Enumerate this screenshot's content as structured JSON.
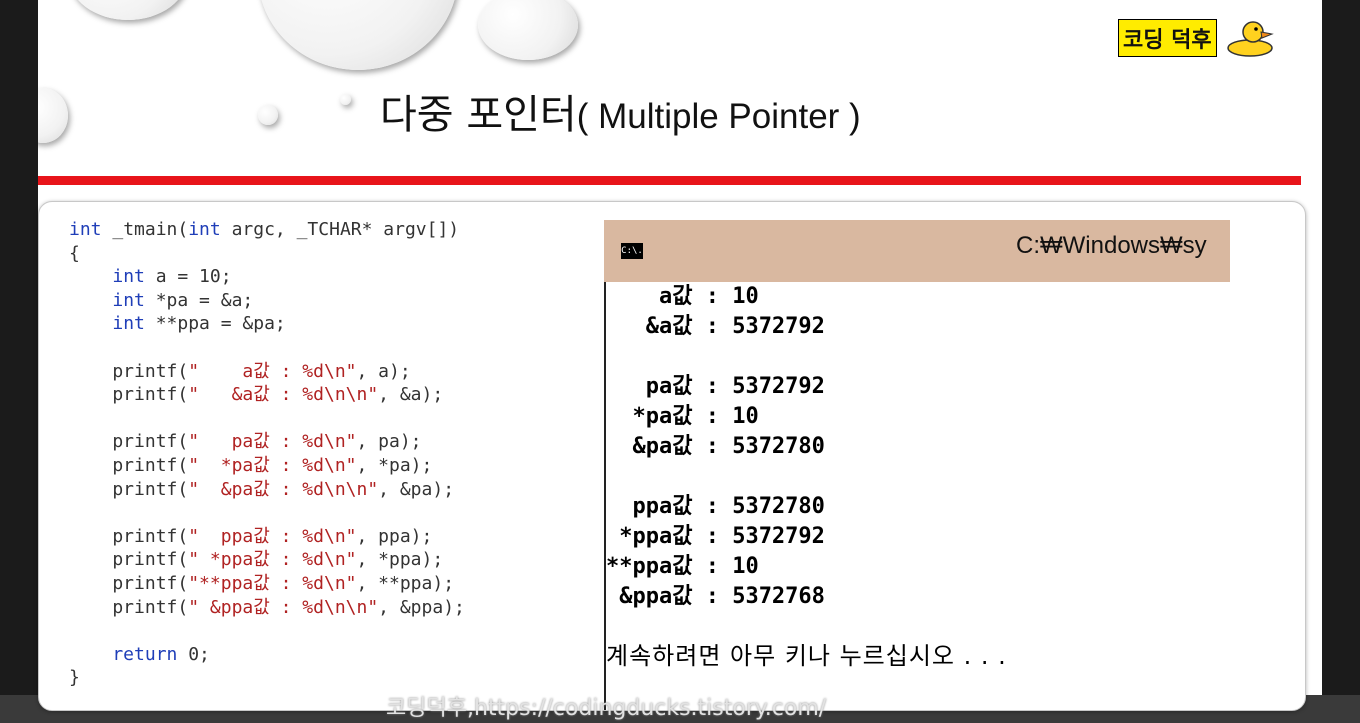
{
  "slide": {
    "title_korean": "다중 포인터",
    "title_english": "( Multiple Pointer )",
    "brand": "코딩 덕후",
    "watermark": "코딩덕후,https://codingducks.tistory.com/"
  },
  "code_lines": [
    [
      {
        "t": "int",
        "c": "kw"
      },
      {
        "t": " _tmain("
      },
      {
        "t": "int",
        "c": "kw"
      },
      {
        "t": " argc, _TCHAR* argv[])"
      }
    ],
    [
      {
        "t": "{"
      }
    ],
    [
      {
        "t": "    "
      },
      {
        "t": "int",
        "c": "kw"
      },
      {
        "t": " a = 10;"
      }
    ],
    [
      {
        "t": "    "
      },
      {
        "t": "int",
        "c": "kw"
      },
      {
        "t": " *pa = &a;"
      }
    ],
    [
      {
        "t": "    "
      },
      {
        "t": "int",
        "c": "kw"
      },
      {
        "t": " **ppa = &pa;"
      }
    ],
    [],
    [
      {
        "t": "    printf("
      },
      {
        "t": "\"    a값 : %d\\n\"",
        "c": "str"
      },
      {
        "t": ", a);"
      }
    ],
    [
      {
        "t": "    printf("
      },
      {
        "t": "\"   &a값 : %d\\n\\n\"",
        "c": "str"
      },
      {
        "t": ", &a);"
      }
    ],
    [],
    [
      {
        "t": "    printf("
      },
      {
        "t": "\"   pa값 : %d\\n\"",
        "c": "str"
      },
      {
        "t": ", pa);"
      }
    ],
    [
      {
        "t": "    printf("
      },
      {
        "t": "\"  *pa값 : %d\\n\"",
        "c": "str"
      },
      {
        "t": ", *pa);"
      }
    ],
    [
      {
        "t": "    printf("
      },
      {
        "t": "\"  &pa값 : %d\\n\\n\"",
        "c": "str"
      },
      {
        "t": ", &pa);"
      }
    ],
    [],
    [
      {
        "t": "    printf("
      },
      {
        "t": "\"  ppa값 : %d\\n\"",
        "c": "str"
      },
      {
        "t": ", ppa);"
      }
    ],
    [
      {
        "t": "    printf("
      },
      {
        "t": "\" *ppa값 : %d\\n\"",
        "c": "str"
      },
      {
        "t": ", *ppa);"
      }
    ],
    [
      {
        "t": "    printf("
      },
      {
        "t": "\"**ppa값 : %d\\n\"",
        "c": "str"
      },
      {
        "t": ", **ppa);"
      }
    ],
    [
      {
        "t": "    printf("
      },
      {
        "t": "\" &ppa값 : %d\\n\\n\"",
        "c": "str"
      },
      {
        "t": ", &ppa);"
      }
    ],
    [],
    [
      {
        "t": "    return",
        "c": "kw"
      },
      {
        "t": " 0;"
      }
    ],
    [
      {
        "t": "}"
      }
    ]
  ],
  "console": {
    "icon_label": "C:\\.",
    "title": "C:₩Windows₩sy",
    "output_lines": [
      "    a값 : 10",
      "   &a값 : 5372792",
      "",
      "   pa값 : 5372792",
      "  *pa값 : 10",
      "  &pa값 : 5372780",
      "",
      "  ppa값 : 5372780",
      " *ppa값 : 5372792",
      "**ppa값 : 10",
      " &ppa값 : 5372768"
    ],
    "prompt": "계속하려면 아무 키나 누르십시오 . . ."
  }
}
